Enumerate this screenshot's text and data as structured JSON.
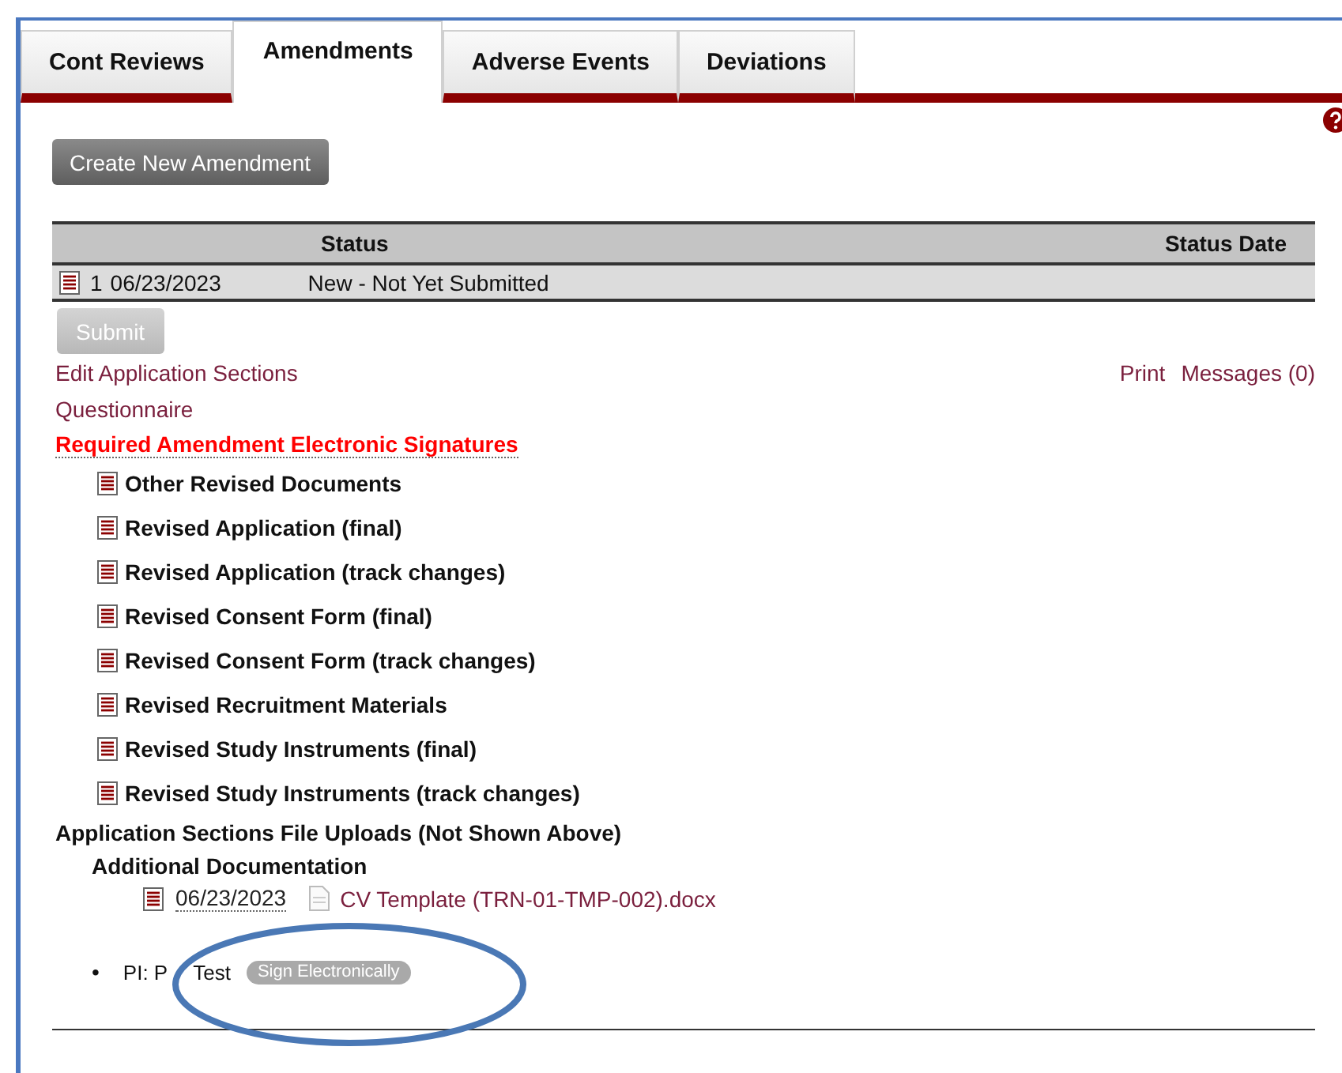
{
  "tabs": [
    {
      "label": "Cont Reviews",
      "selected": false
    },
    {
      "label": "Amendments",
      "selected": true
    },
    {
      "label": "Adverse Events",
      "selected": false
    },
    {
      "label": "Deviations",
      "selected": false
    }
  ],
  "create_button": {
    "label": "Create New Amendment"
  },
  "table": {
    "columns": [
      {
        "label": "Status"
      },
      {
        "label": "Status Date"
      }
    ],
    "rows": [
      {
        "number": "1",
        "date": "06/23/2023",
        "status": "New - Not Yet Submitted"
      }
    ]
  },
  "submit_button": {
    "label": "Submit",
    "disabled": true
  },
  "links_left": [
    "Edit Application Sections"
  ],
  "links_right": [
    "Print",
    "Messages (0)"
  ],
  "questionnaire_link": "Questionnaire",
  "signatures": {
    "heading": "Required Amendment Electronic Signatures",
    "documents": [
      "Other Revised Documents",
      "Revised Application (final)",
      "Revised Application (track changes)",
      "Revised Consent Form (final)",
      "Revised Consent Form (track changes)",
      "Revised Recruitment Materials",
      "Revised Study Instruments (final)",
      "Revised Study Instruments (track changes)"
    ]
  },
  "uploads": {
    "heading": "Application Sections File Uploads (Not Shown Above)",
    "sections": [
      {
        "title": "Additional Documentation",
        "files": [
          {
            "date": "06/23/2023",
            "name": "CV Template (TRN-01-TMP-002).docx"
          }
        ]
      }
    ]
  },
  "signers": [
    {
      "bullet": "•",
      "label": "PI: P",
      "label_continued": "Test",
      "action": {
        "label": "Sign Electronically",
        "disabled": true
      }
    }
  ]
}
